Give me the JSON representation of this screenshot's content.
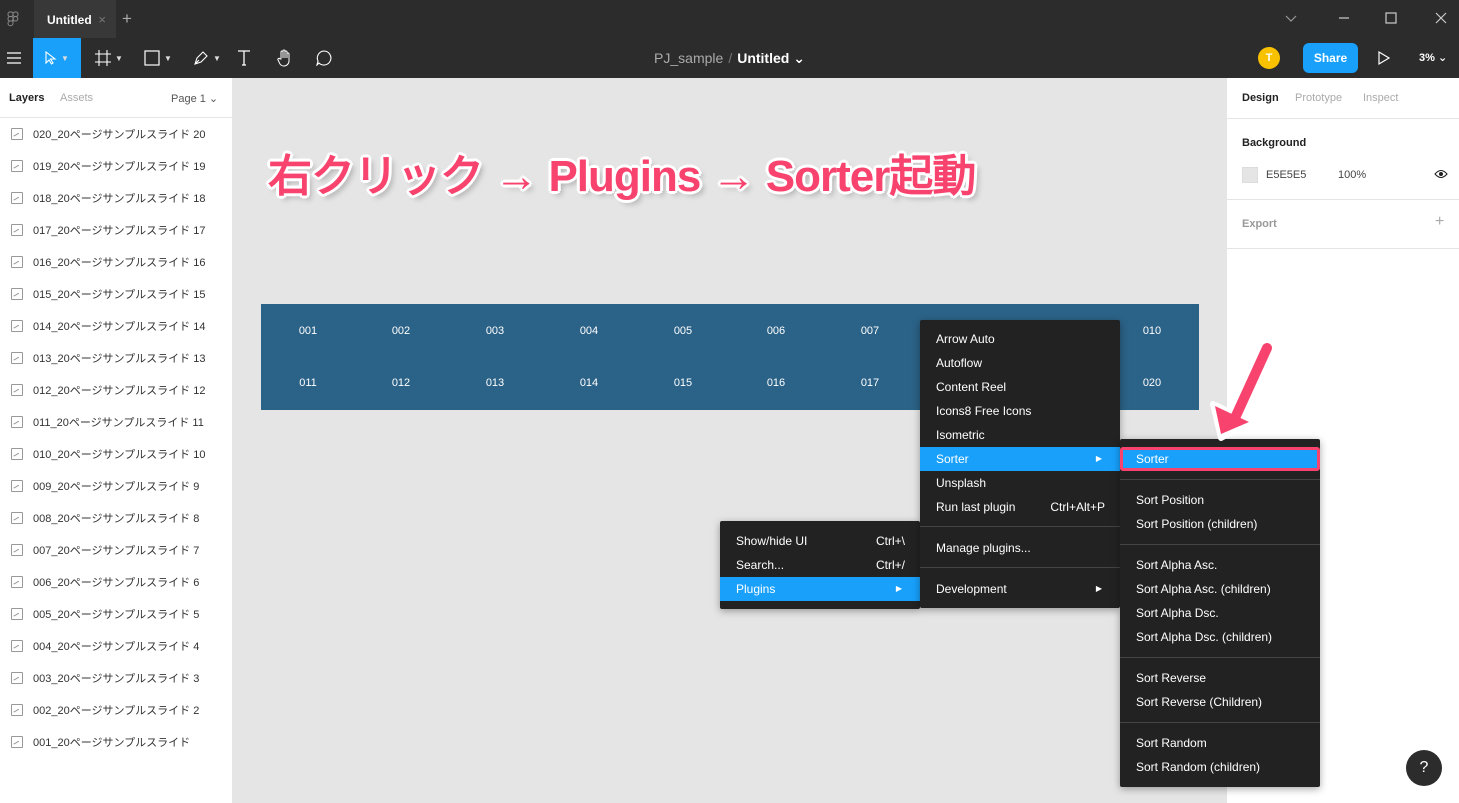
{
  "titlebar": {
    "tab_title": "Untitled",
    "tab_close": "×",
    "new_tab": "+"
  },
  "toolbar": {
    "project": "PJ_sample",
    "separator": "/",
    "file": "Untitled ⌄",
    "avatar_initial": "T",
    "share_label": "Share",
    "zoom": "3% ⌄"
  },
  "left_panel": {
    "tab_layers": "Layers",
    "tab_assets": "Assets",
    "page": "Page 1 ⌄",
    "layers": [
      "020_20ページサンプルスライド 20",
      "019_20ページサンプルスライド 19",
      "018_20ページサンプルスライド 18",
      "017_20ページサンプルスライド 17",
      "016_20ページサンプルスライド 16",
      "015_20ページサンプルスライド 15",
      "014_20ページサンプルスライド 14",
      "013_20ページサンプルスライド 13",
      "012_20ページサンプルスライド 12",
      "011_20ページサンプルスライド 11",
      "010_20ページサンプルスライド 10",
      "009_20ページサンプルスライド 9",
      "008_20ページサンプルスライド 8",
      "007_20ページサンプルスライド 7",
      "006_20ページサンプルスライド 6",
      "005_20ページサンプルスライド 5",
      "004_20ページサンプルスライド 4",
      "003_20ページサンプルスライド 3",
      "002_20ページサンプルスライド 2",
      "001_20ページサンプルスライド"
    ]
  },
  "right_panel": {
    "tab_design": "Design",
    "tab_prototype": "Prototype",
    "tab_inspect": "Inspect",
    "background_label": "Background",
    "bg_hex": "E5E5E5",
    "bg_opacity": "100%",
    "export_label": "Export",
    "export_add": "+"
  },
  "canvas": {
    "annotation": "右クリック → Plugins → Sorter起動",
    "slides_row1": [
      "001",
      "002",
      "003",
      "004",
      "005",
      "006",
      "007",
      "",
      "",
      "010"
    ],
    "slides_row2": [
      "011",
      "012",
      "013",
      "014",
      "015",
      "016",
      "017",
      "",
      "",
      "020"
    ]
  },
  "context_menu": {
    "items": [
      {
        "label": "Show/hide UI",
        "shortcut": "Ctrl+\\"
      },
      {
        "label": "Search...",
        "shortcut": "Ctrl+/"
      },
      {
        "label": "Plugins",
        "shortcut": "▶"
      }
    ]
  },
  "plugins_menu": {
    "items": [
      "Arrow Auto",
      "Autoflow",
      "Content Reel",
      "Icons8 Free Icons",
      "Isometric",
      "Sorter",
      "Unsplash"
    ],
    "run_last": "Run last plugin",
    "run_last_shortcut": "Ctrl+Alt+P",
    "manage": "Manage plugins...",
    "development": "Development",
    "arrow": "▶"
  },
  "sorter_menu": {
    "title": "Sorter",
    "groups": [
      [
        "Sort Position",
        "Sort Position (children)"
      ],
      [
        "Sort Alpha Asc.",
        "Sort Alpha Asc. (children)",
        "Sort Alpha Dsc.",
        "Sort Alpha Dsc. (children)"
      ],
      [
        "Sort Reverse",
        "Sort Reverse (Children)"
      ],
      [
        "Sort Random",
        "Sort Random (children)"
      ]
    ]
  },
  "help_label": "?",
  "colors": {
    "accent": "#18a0fb",
    "annotation": "#f7436d",
    "frame": "#2b6287"
  }
}
